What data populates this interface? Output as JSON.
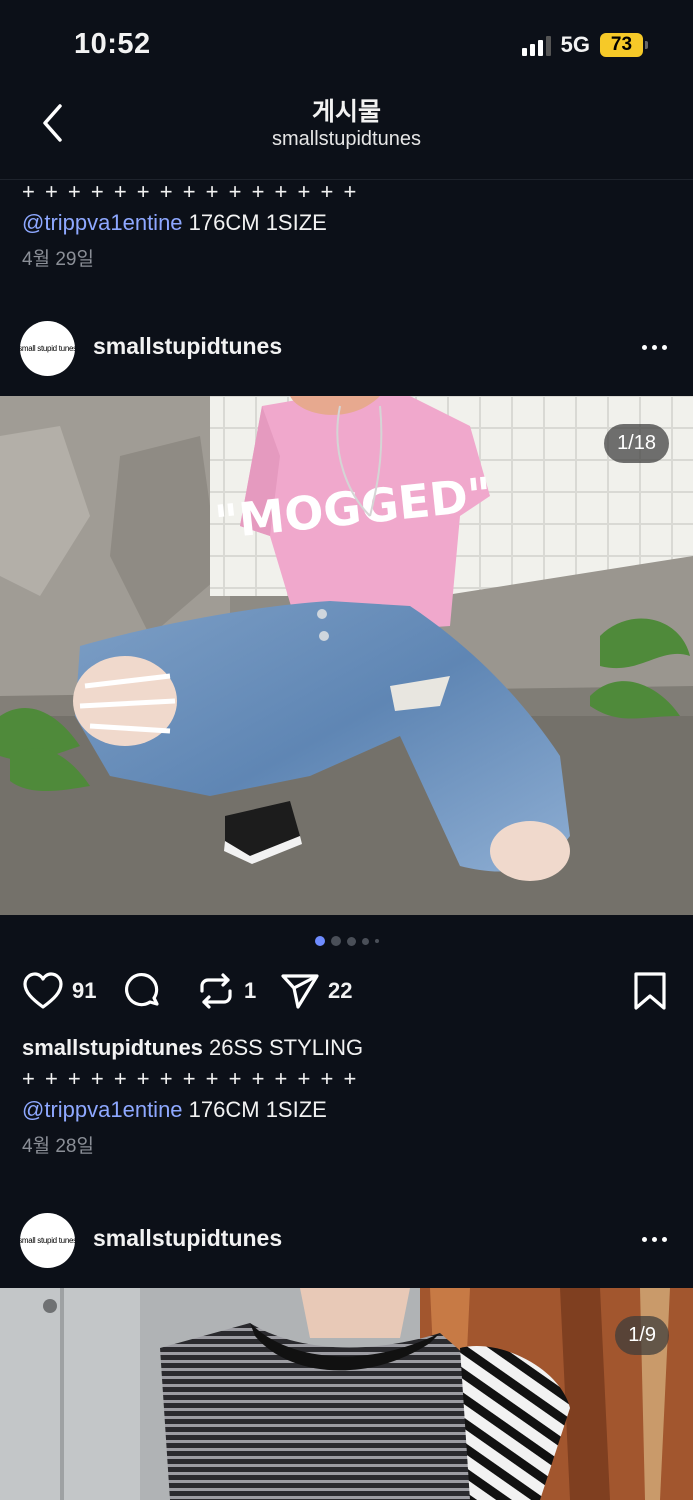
{
  "status": {
    "time": "10:52",
    "network": "5G",
    "battery": "73"
  },
  "header": {
    "title": "게시물",
    "subtitle": "smallstupidtunes"
  },
  "prev_post": {
    "plus_line": "+ + + + + + + + + + + + + + +",
    "mention": "@trippva1entine",
    "size_text": " 176CM 1SIZE",
    "date": "4월 29일"
  },
  "post": {
    "avatar_text": "small stupid tunes",
    "username": "smallstupidtunes",
    "counter": "1/18",
    "likes": "91",
    "reposts": "1",
    "shares": "22",
    "caption_user": "smallstupidtunes",
    "caption_text": " 26SS STYLING",
    "plus_line": "+ + + + + + + + + + + + + + +",
    "mention": "@trippva1entine",
    "size_text": " 176CM 1SIZE",
    "date": "4월 28일",
    "shirt_text": "\"MOGGED\""
  },
  "next_post": {
    "avatar_text": "small stupid tunes",
    "username": "smallstupidtunes",
    "counter": "1/9"
  },
  "colors": {
    "background": "#0c1018",
    "mention": "#8ea8ff",
    "dot_active": "#6f8cff",
    "battery": "#f6c928"
  }
}
